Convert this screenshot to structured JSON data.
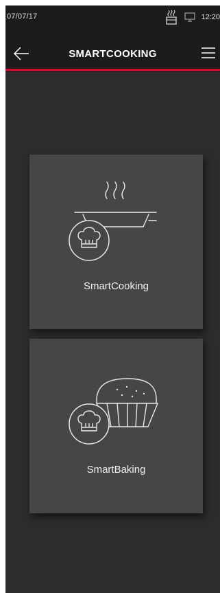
{
  "status": {
    "date": "07/07/17",
    "time": "12:20",
    "icons": [
      "oven-heat-icon",
      "monitor-icon"
    ]
  },
  "header": {
    "title": "SMARTCOOKING",
    "back_icon": "arrow-left-icon",
    "menu_icon": "hamburger-menu-icon"
  },
  "tiles": [
    {
      "label": "SmartCooking",
      "icon": "pan-steam-chef-hat-icon"
    },
    {
      "label": "SmartBaking",
      "icon": "pie-chef-hat-icon"
    }
  ],
  "colors": {
    "accent": "#c8102e",
    "background": "#2c2c2c",
    "topbar": "#1b1b1b",
    "tile": "#464646",
    "text": "#ffffff"
  }
}
